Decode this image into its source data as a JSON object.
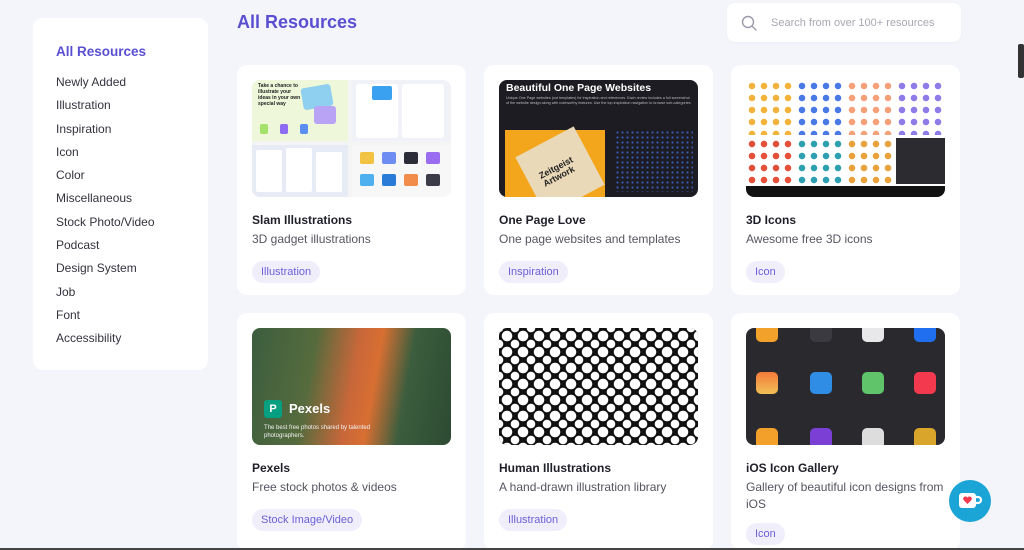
{
  "sidebar": {
    "title": "All Resources",
    "items": [
      {
        "label": "Newly Added"
      },
      {
        "label": "Illustration"
      },
      {
        "label": "Inspiration"
      },
      {
        "label": "Icon"
      },
      {
        "label": "Color"
      },
      {
        "label": "Miscellaneous"
      },
      {
        "label": "Stock Photo/Video"
      },
      {
        "label": "Podcast"
      },
      {
        "label": "Design System"
      },
      {
        "label": "Job"
      },
      {
        "label": "Font"
      },
      {
        "label": "Accessibility"
      }
    ]
  },
  "header": {
    "title": "All Resources",
    "search_placeholder": "Search from over 100+ resources"
  },
  "cards": [
    {
      "title": "Slam Illustrations",
      "desc": "3D gadget illustrations",
      "tag": "Illustration",
      "thumb_text": "Take a chance to illustrate your ideas in your own special way"
    },
    {
      "title": "One Page Love",
      "desc": "One page websites and templates",
      "tag": "Inspiration",
      "thumb_text": "Beautiful One Page Websites",
      "thumb_sub": "Unique One Page websites (not templates) for inspiration and references. Each review includes a full screenshot of the website design along with noteworthy features. Use the top inspiration navigation to browse sub-categories.",
      "thumb_book": "Zeitgeist Artwork"
    },
    {
      "title": "3D Icons",
      "desc": "Awesome free 3D icons",
      "tag": "Icon"
    },
    {
      "title": "Pexels",
      "desc": "Free stock photos & videos",
      "tag": "Stock Image/Video",
      "thumb_text": "Pexels",
      "thumb_sub": "The best free photos shared by talented photographers."
    },
    {
      "title": "Human Illustrations",
      "desc": "A hand-drawn illustration library",
      "tag": "Illustration"
    },
    {
      "title": "iOS Icon Gallery",
      "desc": "Gallery of beautiful icon designs from iOS",
      "tag": "Icon"
    }
  ],
  "colors": {
    "accent": "#5a4fd1",
    "tag_bg": "#f0eefb",
    "tag_text": "#6b5fd6",
    "fab": "#1aa5d6"
  },
  "icons": {
    "search": "search-icon",
    "fab": "kofi-cup-icon"
  }
}
